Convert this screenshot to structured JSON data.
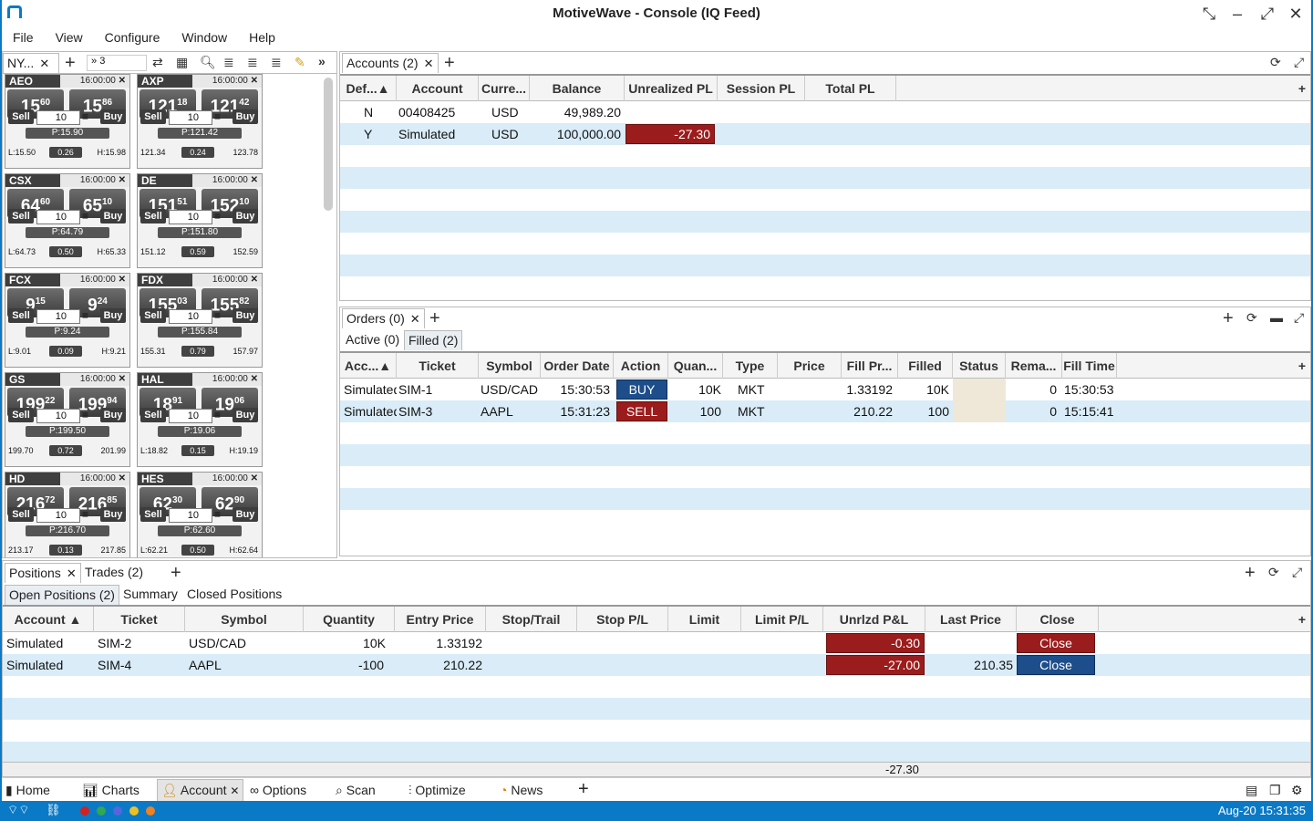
{
  "app": {
    "title": "MotiveWave - Console (IQ Feed)"
  },
  "menu": [
    "File",
    "View",
    "Configure",
    "Window",
    "Help"
  ],
  "watchlist": {
    "tab_label": "NY...",
    "count_label": "3",
    "tiles": [
      {
        "symbol": "AEO",
        "time": "16:00:00",
        "bid_main": "15",
        "bid_sup": "60",
        "ask_main": "15",
        "ask_sup": "86",
        "sell": "Sell",
        "buy": "Buy",
        "qty": "10",
        "p": "P:15.90",
        "low": "L:15.50",
        "chg": "0.26",
        "high": "H:15.98"
      },
      {
        "symbol": "AXP",
        "time": "16:00:00",
        "bid_main": "121",
        "bid_sup": "18",
        "ask_main": "121",
        "ask_sup": "42",
        "sell": "Sell",
        "buy": "Buy",
        "qty": "10",
        "p": "P:121.42",
        "low": "121.34",
        "chg": "0.24",
        "high": "123.78"
      },
      {
        "symbol": "CSX",
        "time": "16:00:00",
        "bid_main": "64",
        "bid_sup": "60",
        "ask_main": "65",
        "ask_sup": "10",
        "sell": "Sell",
        "buy": "Buy",
        "qty": "10",
        "p": "P:64.79",
        "low": "L:64.73",
        "chg": "0.50",
        "high": "H:65.33"
      },
      {
        "symbol": "DE",
        "time": "16:00:00",
        "bid_main": "151",
        "bid_sup": "51",
        "ask_main": "152",
        "ask_sup": "10",
        "sell": "Sell",
        "buy": "Buy",
        "qty": "10",
        "p": "P:151.80",
        "low": "151.12",
        "chg": "0.59",
        "high": "152.59"
      },
      {
        "symbol": "FCX",
        "time": "16:00:00",
        "bid_main": "9",
        "bid_sup": "15",
        "ask_main": "9",
        "ask_sup": "24",
        "sell": "Sell",
        "buy": "Buy",
        "qty": "10",
        "p": "P:9.24",
        "low": "L:9.01",
        "chg": "0.09",
        "high": "H:9.21"
      },
      {
        "symbol": "FDX",
        "time": "16:00:00",
        "bid_main": "155",
        "bid_sup": "03",
        "ask_main": "155",
        "ask_sup": "82",
        "sell": "Sell",
        "buy": "Buy",
        "qty": "10",
        "p": "P:155.84",
        "low": "155.31",
        "chg": "0.79",
        "high": "157.97"
      },
      {
        "symbol": "GS",
        "time": "16:00:00",
        "bid_main": "199",
        "bid_sup": "22",
        "ask_main": "199",
        "ask_sup": "94",
        "sell": "Sell",
        "buy": "Buy",
        "qty": "10",
        "p": "P:199.50",
        "low": "199.70",
        "chg": "0.72",
        "high": "201.99"
      },
      {
        "symbol": "HAL",
        "time": "16:00:00",
        "bid_main": "18",
        "bid_sup": "91",
        "ask_main": "19",
        "ask_sup": "06",
        "sell": "Sell",
        "buy": "Buy",
        "qty": "10",
        "p": "P:19.06",
        "low": "L:18.82",
        "chg": "0.15",
        "high": "H:19.19"
      },
      {
        "symbol": "HD",
        "time": "16:00:00",
        "bid_main": "216",
        "bid_sup": "72",
        "ask_main": "216",
        "ask_sup": "85",
        "sell": "Sell",
        "buy": "Buy",
        "qty": "10",
        "p": "P:216.70",
        "low": "213.17",
        "chg": "0.13",
        "high": "217.85"
      },
      {
        "symbol": "HES",
        "time": "16:00:00",
        "bid_main": "62",
        "bid_sup": "30",
        "ask_main": "62",
        "ask_sup": "90",
        "sell": "Sell",
        "buy": "Buy",
        "qty": "10",
        "p": "P:62.60",
        "low": "L:62.21",
        "chg": "0.50",
        "high": "H:62.64"
      }
    ]
  },
  "accounts": {
    "tab_label": "Accounts (2)",
    "columns": [
      "Def...▲",
      "Account",
      "Curre...",
      "Balance",
      "Unrealized PL",
      "Session PL",
      "Total PL"
    ],
    "rows": [
      {
        "def": "N",
        "account": "00408425",
        "currency": "USD",
        "balance": "49,989.20",
        "unrealized": ""
      },
      {
        "def": "Y",
        "account": "Simulated",
        "currency": "USD",
        "balance": "100,000.00",
        "unrealized": "-27.30"
      }
    ]
  },
  "orders": {
    "tab_label": "Orders (0)",
    "subtabs": [
      "Active (0)",
      "Filled (2)"
    ],
    "columns": [
      "Acc...▲",
      "Ticket",
      "Symbol",
      "Order Date",
      "Action",
      "Quan...",
      "Type",
      "Price",
      "Fill Pr...",
      "Filled",
      "Status",
      "Rema...",
      "Fill Time"
    ],
    "rows": [
      {
        "acc": "Simulated",
        "ticket": "SIM-1",
        "symbol": "USD/CAD",
        "date": "15:30:53",
        "action": "BUY",
        "qty": "10K",
        "type": "MKT",
        "price": "",
        "fill": "1.33192",
        "filled": "10K",
        "status": "",
        "rem": "0",
        "time": "15:30:53"
      },
      {
        "acc": "Simulated",
        "ticket": "SIM-3",
        "symbol": "AAPL",
        "date": "15:31:23",
        "action": "SELL",
        "qty": "100",
        "type": "MKT",
        "price": "",
        "fill": "210.22",
        "filled": "100",
        "status": "",
        "rem": "0",
        "time": "15:15:41"
      }
    ]
  },
  "positions": {
    "tabs": [
      "Positions",
      "Trades (2)"
    ],
    "subtabs": [
      "Open Positions (2)",
      "Summary",
      "Closed Positions"
    ],
    "columns": [
      "Account ▲",
      "Ticket",
      "Symbol",
      "Quantity",
      "Entry Price",
      "Stop/Trail",
      "Stop P/L",
      "Limit",
      "Limit P/L",
      "Unrlzd P&L",
      "Last Price",
      "Close"
    ],
    "rows": [
      {
        "account": "Simulated",
        "ticket": "SIM-2",
        "symbol": "USD/CAD",
        "qty": "10K",
        "entry": "1.33192",
        "unrl": "-0.30",
        "last": "",
        "close": "Close"
      },
      {
        "account": "Simulated",
        "ticket": "SIM-4",
        "symbol": "AAPL",
        "qty": "-100",
        "entry": "210.22",
        "unrl": "-27.00",
        "last": "210.35",
        "close": "Close"
      }
    ],
    "total": "-27.30"
  },
  "bottom_tabs": [
    "Home",
    "Charts",
    "Account",
    "Options",
    "Scan",
    "Optimize",
    "News"
  ],
  "status": {
    "datetime": "Aug-20 15:31:35"
  },
  "colors": {
    "accent": "#0b7ac6",
    "loss": "#9b1c1c",
    "buy": "#1d4d8a",
    "row_alt": "#d9ecf8"
  }
}
